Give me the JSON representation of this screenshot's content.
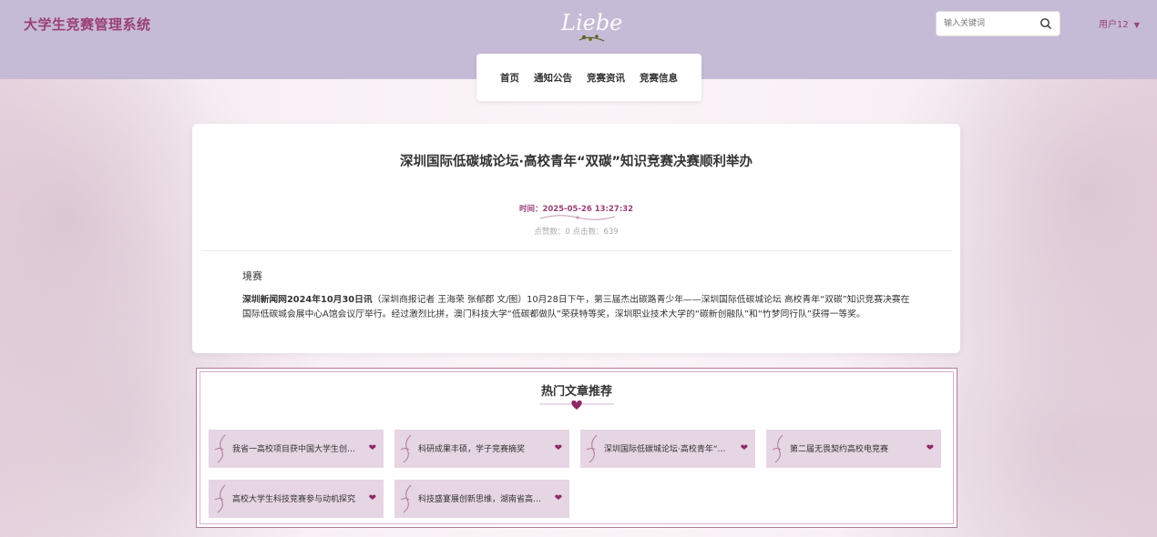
{
  "header": {
    "site_title": "大学生竞赛管理系统",
    "search_placeholder": "输入关键词",
    "user_label": "用户12"
  },
  "nav": {
    "items": [
      "首页",
      "通知公告",
      "竞赛资讯",
      "竞赛信息"
    ]
  },
  "article": {
    "title": "深圳国际低碳城论坛·高校青年“双碳”知识竞赛决赛顺利举办",
    "time": "时间：2025-05-26 13:27:32",
    "stats": "点赞数：0    点击数：639",
    "section_label": "境赛",
    "body_lead": "深圳新闻网2024年10月30日讯",
    "body_rest": "（深圳商报记者 王海荣 张郁郡 文/图）10月28日下午，第三届杰出碳路青少年——深圳国际低碳城论坛 高校青年“双碳”知识竞赛决赛在国际低碳城会展中心A馆会议厅举行。经过激烈比拼，澳门科技大学“低碳都做队”荣获特等奖，深圳职业技术大学的“碳新创融队”和“竹梦同行队”获得一等奖。"
  },
  "hot": {
    "title": "热门文章推荐",
    "items": [
      "我省一高校项目获中国大学生创业...",
      "科研成果丰硕，学子竞赛摘奖",
      "深圳国际低碳城论坛·高校青年“双...",
      "第二届无畏契约高校电竞赛",
      "高校大学生科技竞赛参与动机探究",
      "科技盛宴展创新思维，湖南省高校..."
    ]
  },
  "colors": {
    "header_bg": "#c6bbd6",
    "accent": "#9b3f78",
    "card_item_bg": "#e6d5e3"
  },
  "icons": {
    "search": "search-icon",
    "heart": "heart-icon",
    "caret": "chevron-down-icon"
  }
}
